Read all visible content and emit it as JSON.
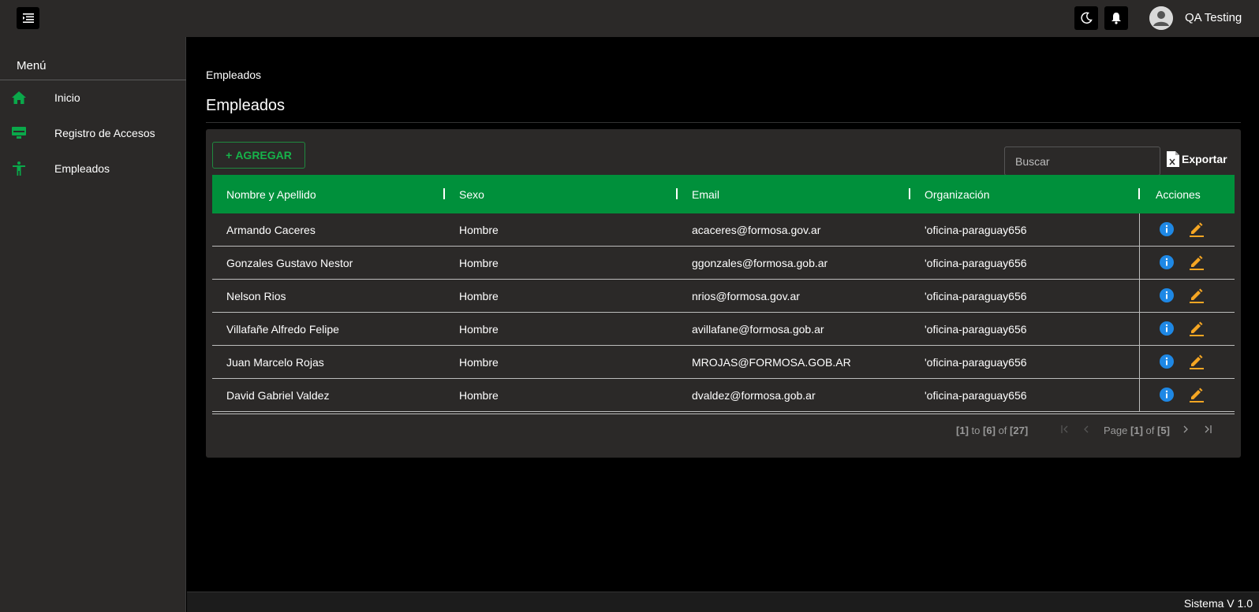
{
  "topbar": {
    "user_name": "QA Testing"
  },
  "sidebar": {
    "title": "Menú",
    "items": [
      {
        "label": "Inicio",
        "icon": "home-icon"
      },
      {
        "label": "Registro de Accesos",
        "icon": "monitor-icon"
      },
      {
        "label": "Empleados",
        "icon": "accessibility-icon"
      }
    ]
  },
  "main": {
    "breadcrumb": "Empleados",
    "title": "Empleados",
    "add_label": "AGREGAR",
    "search_placeholder": "Buscar",
    "export_label": "Exportar",
    "columns": [
      "Nombre y Apellido",
      "Sexo",
      "Email",
      "Organización",
      "Acciones"
    ],
    "rows": [
      [
        "Armando Caceres",
        "Hombre",
        "acaceres@formosa.gov.ar",
        "'oficina-paraguay656"
      ],
      [
        "Gonzales Gustavo Nestor",
        "Hombre",
        "ggonzales@formosa.gob.ar",
        "'oficina-paraguay656"
      ],
      [
        "Nelson Rios",
        "Hombre",
        "nrios@formosa.gov.ar",
        "'oficina-paraguay656"
      ],
      [
        "Villafañe Alfredo Felipe",
        "Hombre",
        "avillafane@formosa.gob.ar",
        "'oficina-paraguay656"
      ],
      [
        "Juan Marcelo Rojas",
        "Hombre",
        "MROJAS@FORMOSA.GOB.AR",
        "'oficina-paraguay656"
      ],
      [
        "David Gabriel Valdez",
        "Hombre",
        "dvaldez@formosa.gob.ar",
        "'oficina-paraguay656"
      ]
    ],
    "pager": {
      "from": "1",
      "to": "6",
      "total": "27",
      "page": "1",
      "pages": "5",
      "to_word": "to",
      "of_word": "of",
      "page_word": "Page"
    }
  },
  "footer": {
    "version": "Sistema V 1.0"
  },
  "colors": {
    "accent_green": "#00903b",
    "info_blue": "#1e88e5",
    "edit_orange": "#f5a623"
  }
}
